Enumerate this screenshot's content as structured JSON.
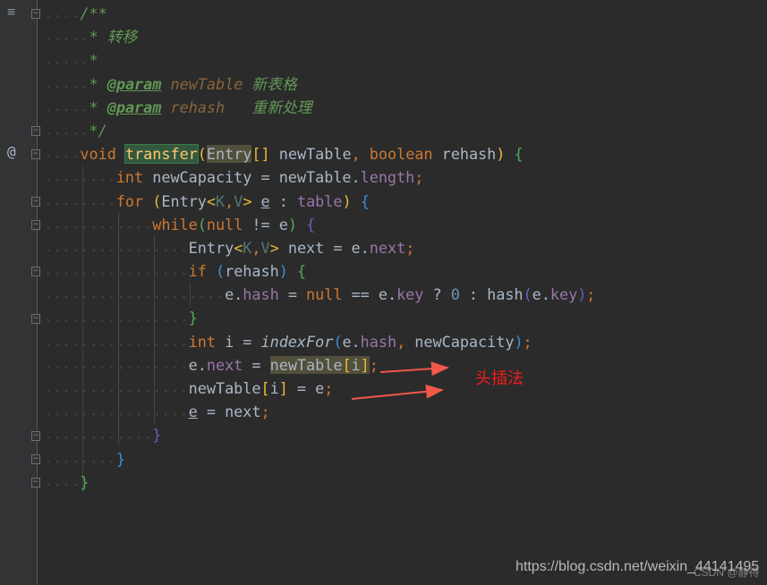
{
  "colors": {
    "keyword": "#cc7832",
    "comment": "#629755",
    "method": "#ffc66d",
    "field": "#9876aa",
    "number": "#6897bb",
    "text": "#a9b7c6",
    "annotation": "#f21c1c"
  },
  "gutter": {
    "structure_icon": "structure-icon",
    "override_marker": "@"
  },
  "code_lines": [
    [
      [
        "    ",
        "ws"
      ],
      [
        "/**",
        "cm"
      ]
    ],
    [
      [
        "     ",
        "ws"
      ],
      [
        "* 转移",
        "cm"
      ]
    ],
    [
      [
        "     ",
        "ws"
      ],
      [
        "*",
        "cm"
      ]
    ],
    [
      [
        "     ",
        "ws"
      ],
      [
        "* ",
        "cm"
      ],
      [
        "@param",
        "tag"
      ],
      [
        " ",
        "cm"
      ],
      [
        "newTable",
        "pn"
      ],
      [
        " 新表格",
        "cm"
      ]
    ],
    [
      [
        "     ",
        "ws"
      ],
      [
        "* ",
        "cm"
      ],
      [
        "@param",
        "tag"
      ],
      [
        " ",
        "cm"
      ],
      [
        "rehash",
        "pn"
      ],
      [
        "   重新处理",
        "cm"
      ]
    ],
    [
      [
        "     ",
        "ws"
      ],
      [
        "*/",
        "cm"
      ]
    ],
    [
      [
        "    ",
        "ws"
      ],
      [
        "void",
        "kw"
      ],
      [
        " ",
        ""
      ],
      [
        "transfer",
        "fn"
      ],
      [
        "(",
        "py"
      ],
      [
        "Entry",
        "hl"
      ],
      [
        "[]",
        "py"
      ],
      [
        " newTable",
        ""
      ],
      [
        ", ",
        "kw"
      ],
      [
        "boolean",
        "kw"
      ],
      [
        " rehash",
        ""
      ],
      [
        ")",
        "py"
      ],
      [
        " ",
        ""
      ],
      [
        "{",
        "pg"
      ]
    ],
    [
      [
        "        ",
        "ws"
      ],
      [
        "int",
        "kw"
      ],
      [
        " newCapacity = newTable.",
        ""
      ],
      [
        "length",
        "fd"
      ],
      [
        ";",
        "kw"
      ]
    ],
    [
      [
        "        ",
        "ws"
      ],
      [
        "for",
        "kw"
      ],
      [
        " ",
        ""
      ],
      [
        "(",
        "py"
      ],
      [
        "Entry",
        ""
      ],
      [
        "<",
        "py"
      ],
      [
        "K",
        "tp"
      ],
      [
        ",",
        "kw"
      ],
      [
        "V",
        "tp"
      ],
      [
        ">",
        "py"
      ],
      [
        " ",
        ""
      ],
      [
        "e",
        "ul"
      ],
      [
        " : ",
        ""
      ],
      [
        "table",
        "fd"
      ],
      [
        ")",
        "py"
      ],
      [
        " ",
        ""
      ],
      [
        "{",
        "pb"
      ]
    ],
    [
      [
        "            ",
        "ws"
      ],
      [
        "while",
        "kw"
      ],
      [
        "(",
        "pg"
      ],
      [
        "null",
        "kw"
      ],
      [
        " != e",
        ""
      ],
      [
        ")",
        "pg"
      ],
      [
        " ",
        ""
      ],
      [
        "{",
        "pp"
      ]
    ],
    [
      [
        "                ",
        "ws"
      ],
      [
        "Entry",
        ""
      ],
      [
        "<",
        "py"
      ],
      [
        "K",
        "tp"
      ],
      [
        ",",
        "kw"
      ],
      [
        "V",
        "tp"
      ],
      [
        ">",
        "py"
      ],
      [
        " next = e.",
        ""
      ],
      [
        "next",
        "fd"
      ],
      [
        ";",
        "kw"
      ]
    ],
    [
      [
        "                ",
        "ws"
      ],
      [
        "if",
        "kw"
      ],
      [
        " ",
        ""
      ],
      [
        "(",
        "pb"
      ],
      [
        "rehash",
        ""
      ],
      [
        ")",
        "pb"
      ],
      [
        " ",
        ""
      ],
      [
        "{",
        "pg"
      ]
    ],
    [
      [
        "                    ",
        "ws"
      ],
      [
        "e.",
        ""
      ],
      [
        "hash",
        "fd"
      ],
      [
        " = ",
        ""
      ],
      [
        "null",
        "kw"
      ],
      [
        " == e.",
        ""
      ],
      [
        "key",
        "fd"
      ],
      [
        " ? ",
        ""
      ],
      [
        "0",
        "num"
      ],
      [
        " : hash",
        ""
      ],
      [
        "(",
        "pp"
      ],
      [
        "e.",
        ""
      ],
      [
        "key",
        "fd"
      ],
      [
        ")",
        "pp"
      ],
      [
        ";",
        "kw"
      ]
    ],
    [
      [
        "                ",
        "ws"
      ],
      [
        "}",
        "pg"
      ]
    ],
    [
      [
        "                ",
        "ws"
      ],
      [
        "int",
        "kw"
      ],
      [
        " i = ",
        ""
      ],
      [
        "indexFor",
        "it"
      ],
      [
        "(",
        "pb"
      ],
      [
        "e.",
        ""
      ],
      [
        "hash",
        "fd"
      ],
      [
        ", ",
        "kw"
      ],
      [
        "newCapacity",
        ""
      ],
      [
        ")",
        "pb"
      ],
      [
        ";",
        "kw"
      ]
    ],
    [
      [
        "                ",
        "ws"
      ],
      [
        "e.",
        ""
      ],
      [
        "next",
        "fd"
      ],
      [
        " = ",
        ""
      ],
      [
        "newTable",
        "hl"
      ],
      [
        "[",
        "py hl"
      ],
      [
        "i",
        "hl"
      ],
      [
        "]",
        "py hl"
      ],
      [
        ";",
        "kw"
      ]
    ],
    [
      [
        "                ",
        "ws"
      ],
      [
        "newTable",
        ""
      ],
      [
        "[",
        "py"
      ],
      [
        "i",
        ""
      ],
      [
        "]",
        "py"
      ],
      [
        " = e",
        ""
      ],
      [
        ";",
        "kw"
      ]
    ],
    [
      [
        "                ",
        "ws"
      ],
      [
        "e",
        "ul"
      ],
      [
        " = next",
        ""
      ],
      [
        ";",
        "kw"
      ]
    ],
    [
      [
        "            ",
        "ws"
      ],
      [
        "}",
        "pp"
      ]
    ],
    [
      [
        "        ",
        "ws"
      ],
      [
        "}",
        "pb"
      ]
    ],
    [
      [
        "    ",
        "ws"
      ],
      [
        "}",
        "pg"
      ]
    ]
  ],
  "annotation": {
    "text": "头插法"
  },
  "watermark": {
    "url": "https://blog.csdn.net/weixin_44141495",
    "overlay": "CSDN @静待"
  }
}
